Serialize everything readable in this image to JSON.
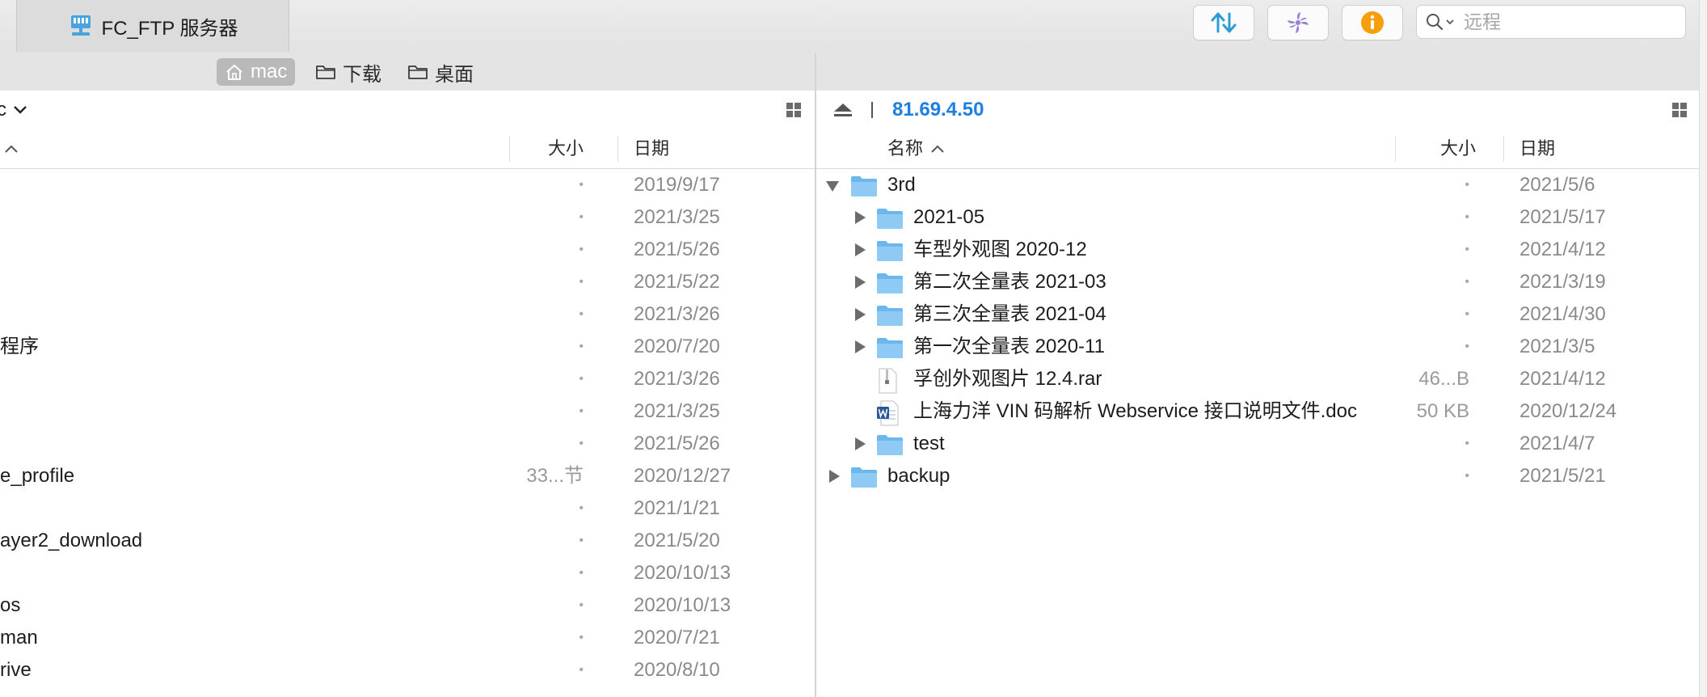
{
  "toolbar": {
    "tab_title": "FC_FTP 服务器",
    "buttons": [
      "transfer-arrows",
      "activity-spinner",
      "info"
    ],
    "search_placeholder": "远程",
    "accent": "#2d9bd6"
  },
  "favorites": [
    {
      "label": "mac",
      "icon": "home-icon",
      "active": true
    },
    {
      "label": "下载",
      "icon": "folder-icon",
      "active": false
    },
    {
      "label": "桌面",
      "icon": "folder-icon",
      "active": false
    }
  ],
  "left": {
    "path_label": "c",
    "columns": {
      "size": "大小",
      "date": "日期"
    },
    "rows": [
      {
        "name": "",
        "size": "•",
        "date": "2019/9/17"
      },
      {
        "name": "",
        "size": "•",
        "date": "2021/3/25"
      },
      {
        "name": "",
        "size": "•",
        "date": "2021/5/26"
      },
      {
        "name": "",
        "size": "•",
        "date": "2021/5/22"
      },
      {
        "name": "",
        "size": "•",
        "date": "2021/3/26"
      },
      {
        "name": "程序",
        "size": "•",
        "date": "2020/7/20"
      },
      {
        "name": "",
        "size": "•",
        "date": "2021/3/26"
      },
      {
        "name": "",
        "size": "•",
        "date": "2021/3/25"
      },
      {
        "name": "",
        "size": "•",
        "date": "2021/5/26"
      },
      {
        "name": "e_profile",
        "size": "33...节",
        "date": "2020/12/27"
      },
      {
        "name": "",
        "size": "•",
        "date": "2021/1/21"
      },
      {
        "name": "ayer2_download",
        "size": "•",
        "date": "2021/5/20"
      },
      {
        "name": "",
        "size": "•",
        "date": "2020/10/13"
      },
      {
        "name": "os",
        "size": "•",
        "date": "2020/10/13"
      },
      {
        "name": "man",
        "size": "•",
        "date": "2020/7/21"
      },
      {
        "name": "rive",
        "size": "•",
        "date": "2020/8/10"
      }
    ]
  },
  "right": {
    "host": "81.69.4.50",
    "columns": {
      "name": "名称",
      "size": "大小",
      "date": "日期"
    },
    "rows": [
      {
        "name": "3rd",
        "size": "•",
        "date": "2021/5/6",
        "depth": 0,
        "type": "folder",
        "expanded": true
      },
      {
        "name": "2021-05",
        "size": "•",
        "date": "2021/5/17",
        "depth": 1,
        "type": "folder",
        "expanded": false
      },
      {
        "name": "车型外观图 2020-12",
        "size": "•",
        "date": "2021/4/12",
        "depth": 1,
        "type": "folder",
        "expanded": false
      },
      {
        "name": "第二次全量表 2021-03",
        "size": "•",
        "date": "2021/3/19",
        "depth": 1,
        "type": "folder",
        "expanded": false
      },
      {
        "name": "第三次全量表 2021-04",
        "size": "•",
        "date": "2021/4/30",
        "depth": 1,
        "type": "folder",
        "expanded": false
      },
      {
        "name": "第一次全量表 2020-11",
        "size": "•",
        "date": "2021/3/5",
        "depth": 1,
        "type": "folder",
        "expanded": false
      },
      {
        "name": "孚创外观图片 12.4.rar",
        "size": "46...B",
        "date": "2021/4/12",
        "depth": 1,
        "type": "rar"
      },
      {
        "name": "上海力洋 VIN 码解析 Webservice 接口说明文件.doc",
        "size": "50 KB",
        "date": "2020/12/24",
        "depth": 1,
        "type": "doc"
      },
      {
        "name": "test",
        "size": "•",
        "date": "2021/4/7",
        "depth": 1,
        "type": "folder",
        "expanded": false
      },
      {
        "name": "backup",
        "size": "•",
        "date": "2021/5/21",
        "depth": 0,
        "type": "folder",
        "expanded": false
      }
    ]
  }
}
